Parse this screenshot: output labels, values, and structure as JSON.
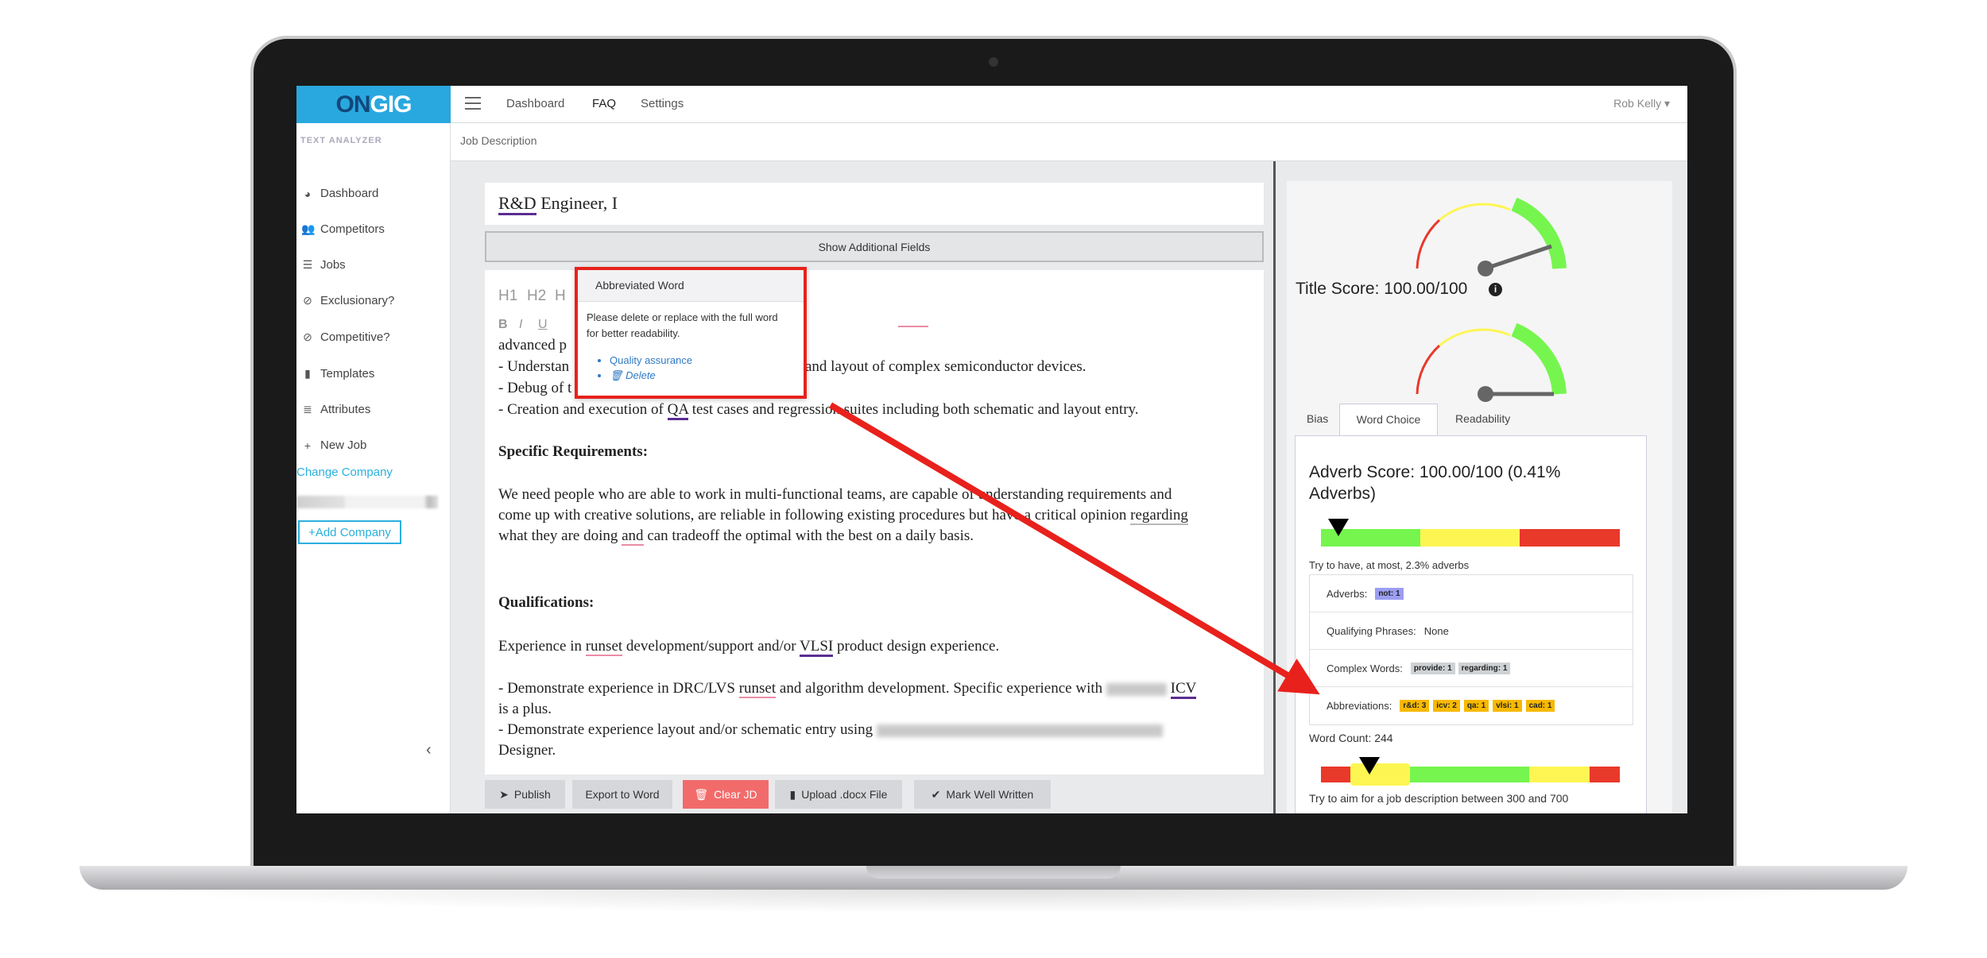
{
  "header": {
    "logo_on": "ON",
    "logo_gig": "GIG",
    "nav": [
      "Dashboard",
      "FAQ",
      "Settings"
    ],
    "user": "Rob Kelly"
  },
  "breadcrumb": "Job Description",
  "sidebar": {
    "heading": "TEXT ANALYZER",
    "items": [
      {
        "label": "Dashboard",
        "icon": "tachometer-icon"
      },
      {
        "label": "Competitors",
        "icon": "users-icon"
      },
      {
        "label": "Jobs",
        "icon": "list-icon"
      },
      {
        "label": "Exclusionary?",
        "icon": "ban-icon"
      },
      {
        "label": "Competitive?",
        "icon": "ban-icon"
      },
      {
        "label": "Templates",
        "icon": "file-icon"
      },
      {
        "label": "Attributes",
        "icon": "list-alt-icon"
      },
      {
        "label": "New Job",
        "icon": "plus-icon"
      }
    ],
    "change_company": "Change Company",
    "add_company": "+Add Company"
  },
  "editor": {
    "title_value": "R&D Engineer, I",
    "title_abbr": "R&D",
    "title_rest": " Engineer, I",
    "show_fields": "Show Additional Fields",
    "toolbar": [
      "H1",
      "H2",
      "H",
      "B",
      "I",
      "U"
    ],
    "lines": {
      "advanced": "advanced p",
      "understand_a": "- Understan",
      "understand_b": "and layout of complex semiconductor devices.",
      "debug": "- Debug of t",
      "creation_a": "- Creation and execution of ",
      "creation_abbr": "QA",
      "creation_b": " test cases and regression suites including both schematic and layout entry.",
      "spec_heading": "Specific Requirements:",
      "p1": "We need people who are able to work in multi-functional teams, are capable of understanding requirements and",
      "p2a": "come up with creative solutions, are reliable in following existing procedures but have a critical opinion ",
      "p2b": "regarding",
      "p3a": "what they are doing ",
      "p3b": "and",
      "p3c": " can tradeoff the optimal with the best on a daily basis.",
      "qual_heading": "Qualifications:",
      "e1a": "Experience in ",
      "e1b": "runset",
      "e1c": " development/support and/or ",
      "e1d": "VLSI",
      "e1e": " product design experience.",
      "d1a": "- Demonstrate experience in DRC/LVS ",
      "d1b": "runset",
      "d1c": " and algorithm development. Specific experience with ",
      "d1d": "ICV",
      "d2": "is a plus.",
      "d3": "- Demonstrate experience layout and/or schematic entry using ",
      "d4": "Designer."
    }
  },
  "popup": {
    "title": "Abbreviated Word",
    "body": "Please delete or replace with the full word for better readability.",
    "options": [
      "Quality assurance",
      "Delete"
    ]
  },
  "actions": {
    "publish": "Publish",
    "export": "Export to Word",
    "clear": "Clear JD",
    "upload": "Upload .docx File",
    "mark": "Mark Well Written"
  },
  "scores": {
    "title_score": "Title Score: 100.00/100",
    "title_gauge_value": 100,
    "second_gauge_value": 100,
    "tabs": [
      "Bias",
      "Word Choice",
      "Readability"
    ],
    "active_tab": "Word Choice",
    "adverb_score": "Adverb Score: 100.00/100 (0.41% Adverbs)",
    "adverb_hint": "Try to have, at most, 2.3% adverbs",
    "rows": {
      "adverbs_label": "Adverbs:",
      "adverbs": [
        "not: 1"
      ],
      "qualifying_label": "Qualifying Phrases:",
      "qualifying_value": "None",
      "complex_label": "Complex Words:",
      "complex": [
        "provide: 1",
        "regarding: 1"
      ],
      "abbr_label": "Abbreviations:",
      "abbr": [
        "r&d: 3",
        "icv: 2",
        "qa: 1",
        "vlsi: 1",
        "cad: 1"
      ]
    },
    "word_count": "Word Count: 244",
    "word_hint": "Try to aim for a job description between 300 and 700"
  },
  "colors": {
    "brand": "#29a8df",
    "green": "#76f54f",
    "yellow": "#fdf652",
    "red": "#e8392b",
    "annotation": "#e8211c",
    "clear_button": "#f26b6b"
  }
}
